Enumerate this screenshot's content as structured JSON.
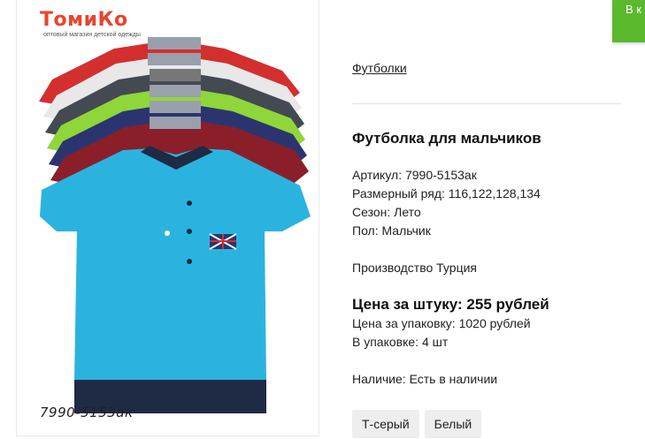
{
  "logo": {
    "name": "ТомиКо",
    "tagline": "оптовый магазин детской одежды"
  },
  "product_image": {
    "caption": "7990-5153ак"
  },
  "cart_button": {
    "label": "В к"
  },
  "breadcrumb": {
    "category": "Футболки"
  },
  "product": {
    "title": "Футболка для мальчиков",
    "article": "Артикул: 7990-5153ак",
    "sizes": "Размерный ряд: 116,122,128,134",
    "season": "Сезон: Лето",
    "gender": "Пол: Мальчик",
    "origin": "Производство Турция",
    "price_unit": "Цена за штуку: 255 рублей",
    "price_pack": "Цена за упаковку: 1020 рублей",
    "pack_qty": "В упаковке: 4 шт",
    "availability": "Наличие: Есть в наличии"
  },
  "color_options": [
    "Т-серый",
    "Белый"
  ],
  "colors": {
    "accent_green": "#5cb82d",
    "shirt_main": "#2bb3e0",
    "shirt_colors": [
      "#d32f2f",
      "#e8e8e8",
      "#444a52",
      "#8fd63a",
      "#2a3570",
      "#8a1f2a"
    ]
  }
}
